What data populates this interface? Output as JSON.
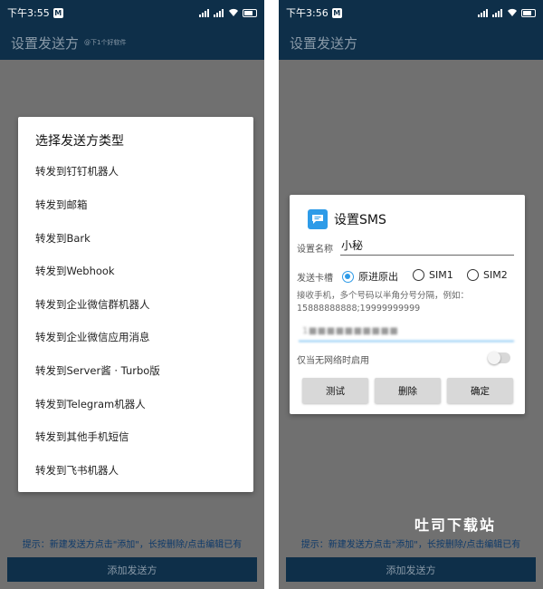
{
  "left": {
    "status_time": "下午3:55",
    "appbar_title": "设置发送方",
    "appbar_sub": "@下1个好软件",
    "dialog_title": "选择发送方类型",
    "options": [
      "转发到钉钉机器人",
      "转发到邮箱",
      "转发到Bark",
      "转发到Webhook",
      "转发到企业微信群机器人",
      "转发到企业微信应用消息",
      "转发到Server酱 · Turbo版",
      "转发到Telegram机器人",
      "转发到其他手机短信",
      "转发到飞书机器人"
    ],
    "hint": "提示：新建发送方点击\"添加\"，长按删除/点击编辑已有",
    "add_button": "添加发送方"
  },
  "right": {
    "status_time": "下午3:56",
    "appbar_title": "设置发送方",
    "dialog_title": "设置SMS",
    "name_label": "设置名称",
    "name_value": "小秘",
    "sim_label": "发送卡槽",
    "sim_options": [
      "原进原出",
      "SIM1",
      "SIM2"
    ],
    "sim_selected": "原进原出",
    "help_text": "接收手机，多个号码以半角分号分隔，例如：15888888888;19999999999",
    "phone_value": "1■■■■■■■■■■",
    "offline_label": "仅当无网络时启用",
    "offline_enabled": false,
    "buttons": [
      "测试",
      "删除",
      "确定"
    ],
    "hint": "提示：新建发送方点击\"添加\"，长按删除/点击编辑已有",
    "add_button": "添加发送方"
  },
  "watermark": "吐司下载站",
  "colors": {
    "primary_dark": "#0e2f49",
    "accent": "#2d9be8",
    "overlay": "#707070"
  }
}
